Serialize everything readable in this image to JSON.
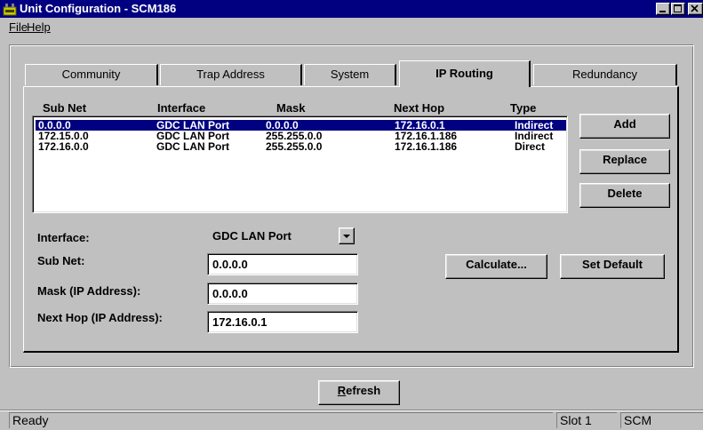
{
  "window": {
    "title": "Unit Configuration - SCM186"
  },
  "menu": [
    {
      "label": "File"
    },
    {
      "label": "Help"
    }
  ],
  "tabs": [
    {
      "label": "Community"
    },
    {
      "label": "Trap Address"
    },
    {
      "label": "System"
    },
    {
      "label": "IP Routing"
    },
    {
      "label": "Redundancy"
    }
  ],
  "routes": {
    "headers": {
      "subnet": "Sub Net",
      "interface": "Interface",
      "mask": "Mask",
      "next_hop": "Next Hop",
      "type": "Type"
    },
    "rows": [
      {
        "subnet": "0.0.0.0",
        "interface": "GDC LAN Port",
        "mask": "0.0.0.0",
        "next_hop": "172.16.0.1",
        "type": "Indirect"
      },
      {
        "subnet": "172.15.0.0",
        "interface": "GDC LAN Port",
        "mask": "255.255.0.0",
        "next_hop": "172.16.1.186",
        "type": "Indirect"
      },
      {
        "subnet": "172.16.0.0",
        "interface": "GDC LAN Port",
        "mask": "255.255.0.0",
        "next_hop": "172.16.1.186",
        "type": "Direct"
      }
    ]
  },
  "buttons": {
    "add": "Add",
    "replace": "Replace",
    "delete": "Delete",
    "calculate": "Calculate...",
    "set_default": "Set Default",
    "refresh_pre": "",
    "refresh_ul": "R",
    "refresh_post": "efresh"
  },
  "form": {
    "interface_label": "Interface:",
    "interface_value": "GDC LAN Port",
    "subnet_label": "Sub Net:",
    "subnet_value": "0.0.0.0",
    "mask_label": "Mask  (IP Address):",
    "mask_value": "0.0.0.0",
    "nexthop_label": "Next Hop  (IP Address):",
    "nexthop_value": "172.16.0.1"
  },
  "status": {
    "message": "Ready",
    "slot": "Slot 1",
    "module": "SCM"
  }
}
